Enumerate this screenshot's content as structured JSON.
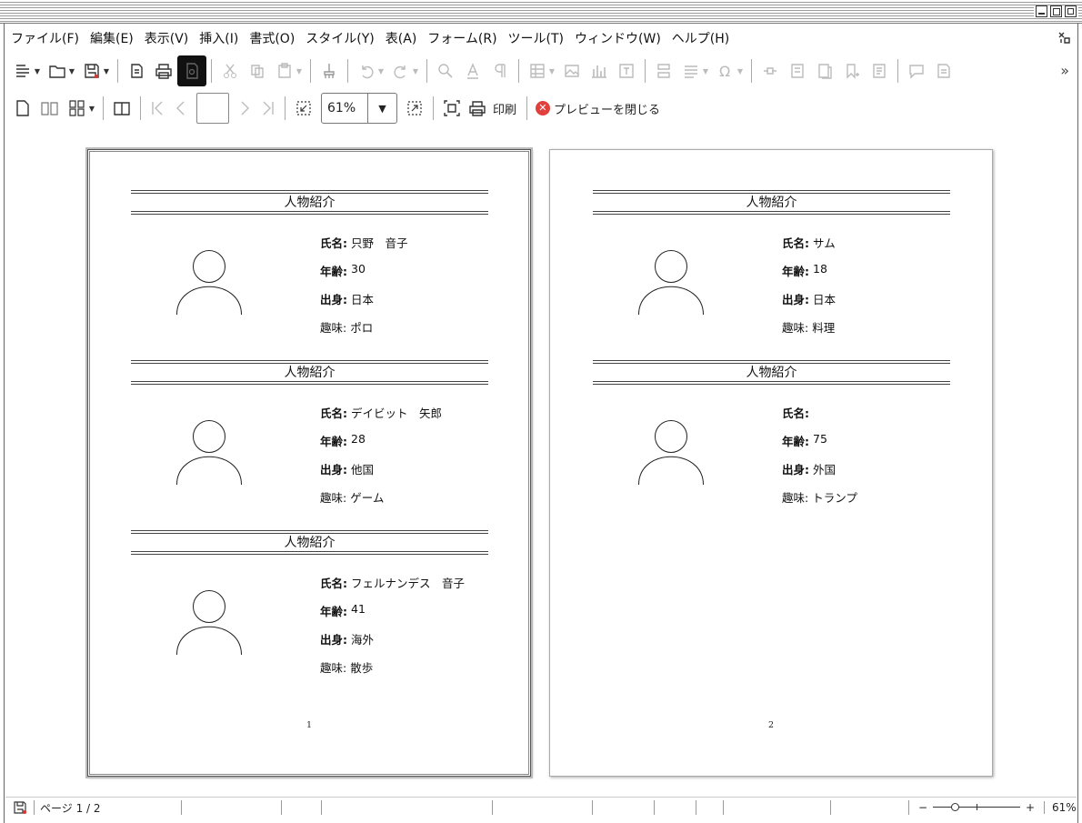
{
  "menubar": {
    "items": [
      "ファイル(F)",
      "編集(E)",
      "表示(V)",
      "挿入(I)",
      "書式(O)",
      "スタイル(Y)",
      "表(A)",
      "フォーム(R)",
      "ツール(T)",
      "ウィンドウ(W)",
      "ヘルプ(H)"
    ]
  },
  "preview_toolbar": {
    "zoom_value": "61%",
    "print_label": "印刷",
    "close_preview_label": "プレビューを閉じる"
  },
  "pages": [
    {
      "profiles": [
        {
          "title": "人物紹介",
          "name_label": "氏名:",
          "name": "只野　音子",
          "age_label": "年齢:",
          "age": "30",
          "origin_label": "出身:",
          "origin": "日本",
          "hobby_label": "趣味:",
          "hobby": "ポロ"
        },
        {
          "title": "人物紹介",
          "name_label": "氏名:",
          "name": "デイビット　矢郎",
          "age_label": "年齢:",
          "age": "28",
          "origin_label": "出身:",
          "origin": "他国",
          "hobby_label": "趣味:",
          "hobby": "ゲーム"
        },
        {
          "title": "人物紹介",
          "name_label": "氏名:",
          "name": "フェルナンデス　音子",
          "age_label": "年齢:",
          "age": "41",
          "origin_label": "出身:",
          "origin": "海外",
          "hobby_label": "趣味:",
          "hobby": "散歩"
        }
      ],
      "page_number": "1"
    },
    {
      "profiles": [
        {
          "title": "人物紹介",
          "name_label": "氏名:",
          "name": "サム",
          "age_label": "年齢:",
          "age": "18",
          "origin_label": "出身:",
          "origin": "日本",
          "hobby_label": "趣味:",
          "hobby": "料理"
        },
        {
          "title": "人物紹介",
          "name_label": "氏名:",
          "name": "",
          "age_label": "年齢:",
          "age": "75",
          "origin_label": "出身:",
          "origin": "外国",
          "hobby_label": "趣味:",
          "hobby": "トランプ"
        }
      ],
      "page_number": "2"
    }
  ],
  "statusbar": {
    "page_info": "ページ 1 / 2",
    "zoom_percent": "61%",
    "zoom_level": 0.61
  }
}
